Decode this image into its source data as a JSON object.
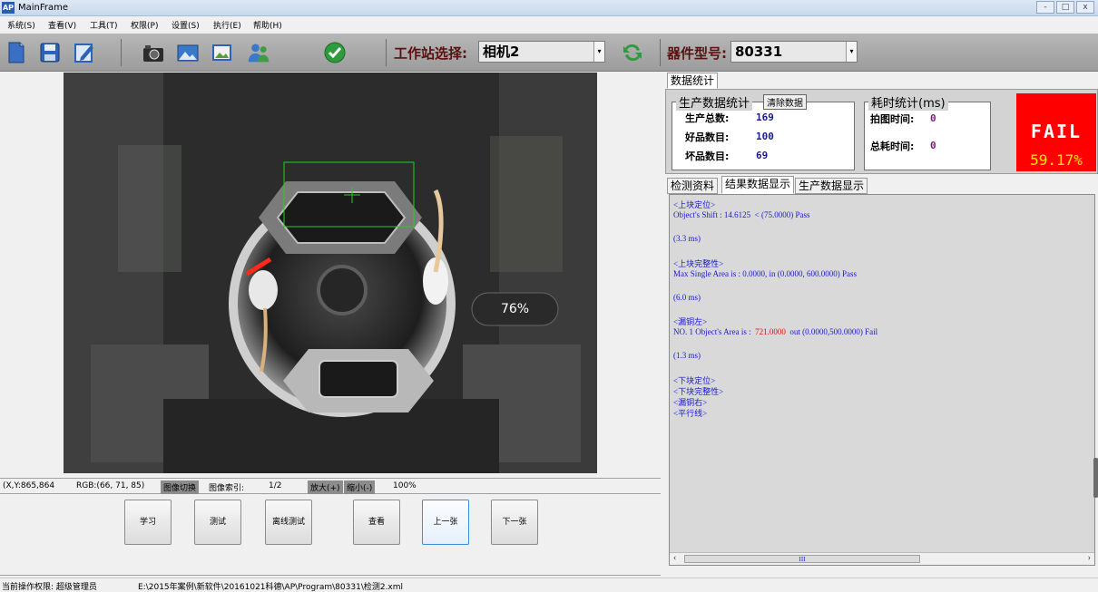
{
  "window": {
    "app_icon": "AP",
    "title": "MainFrame",
    "minimize": "-",
    "maximize": "□",
    "close": "x"
  },
  "menu": [
    "系统(S)",
    "查看(V)",
    "工具(T)",
    "权限(P)",
    "设置(S)",
    "执行(E)",
    "帮助(H)"
  ],
  "toolbar": {
    "station_label": "工作站选择:",
    "station_value": "相机2",
    "model_label": "器件型号:",
    "model_value": "80331",
    "dropdown_arrow": "▾"
  },
  "camera": {
    "zoom_overlay": "76%"
  },
  "info_bar": {
    "coords": "(X,Y:865,864",
    "rgb": "RGB:(66, 71, 85)",
    "switch_label": "图像切换",
    "index_label": "图像索引:",
    "index_value": "1/2",
    "zoom_in": "放大(+)",
    "zoom_out": "缩小(-)",
    "zoom_level": "100%"
  },
  "buttons": [
    "学习",
    "测试",
    "离线测试",
    "查看",
    "上一张",
    "下一张"
  ],
  "stats": {
    "tab": "数据统计",
    "production_group": "生产数据统计",
    "clear_button": "清除数据",
    "total_label": "生产总数:",
    "total_value": "169",
    "good_label": "好品数目:",
    "good_value": "100",
    "bad_label": "坏品数目:",
    "bad_value": "69",
    "time_group": "耗时统计(ms)",
    "capture_label": "拍图时间:",
    "capture_value": "0",
    "total_time_label": "总耗时间:",
    "total_time_value": "0",
    "result": "FAIL",
    "rate": "59.17%",
    "result_color": "#ff0000"
  },
  "tabs": [
    "检测资料",
    "结果数据显示",
    "生产数据显示"
  ],
  "log": {
    "l1": "<上块定位>",
    "l2": "Object's Shift : 14.6125  < (75.0000) Pass",
    "l3": "(3.3 ms)",
    "l4": "<上块完整性>",
    "l5": "Max Single Area is : 0.0000, in (0.0000, 600.0000) Pass",
    "l6": "(6.0 ms)",
    "l7": "<漏铜左>",
    "l8a": "NO. 1 Object's Area is :  ",
    "l8b": "721.0000",
    "l8c": "  out (0.0000,500.0000) Fail",
    "l9": "(1.3 ms)",
    "l10": "<下块定位>",
    "l11": "<下块完整性>",
    "l12": "<漏铜右>",
    "l13": "<平行线>",
    "scroll_left": "‹",
    "scroll_right": "›",
    "scroll_thumb": "III"
  },
  "status": {
    "permission": "当前操作权限:  超级管理员",
    "path": "E:\\2015年案例\\新软件\\20161021科德\\AP\\Program\\80331\\检测2.xml"
  }
}
